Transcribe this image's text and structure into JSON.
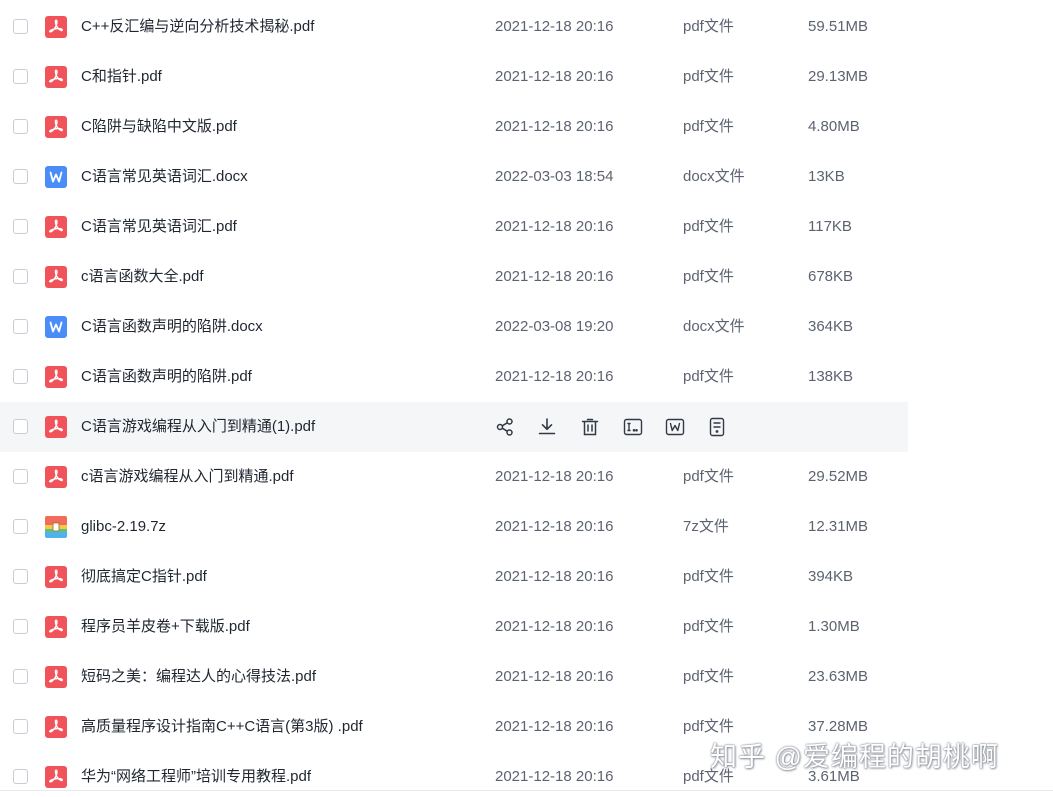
{
  "files": [
    {
      "name": "C++反汇编与逆向分析技术揭秘.pdf",
      "date": "2021-12-18 20:16",
      "type": "pdf文件",
      "size": "59.51MB",
      "icon": "pdf-icon"
    },
    {
      "name": "C和指针.pdf",
      "date": "2021-12-18 20:16",
      "type": "pdf文件",
      "size": "29.13MB",
      "icon": "pdf-icon"
    },
    {
      "name": "C陷阱与缺陷中文版.pdf",
      "date": "2021-12-18 20:16",
      "type": "pdf文件",
      "size": "4.80MB",
      "icon": "pdf-icon"
    },
    {
      "name": "C语言常见英语词汇.docx",
      "date": "2022-03-03 18:54",
      "type": "docx文件",
      "size": "13KB",
      "icon": "word-icon"
    },
    {
      "name": "C语言常见英语词汇.pdf",
      "date": "2021-12-18 20:16",
      "type": "pdf文件",
      "size": "117KB",
      "icon": "pdf-icon"
    },
    {
      "name": "c语言函数大全.pdf",
      "date": "2021-12-18 20:16",
      "type": "pdf文件",
      "size": "678KB",
      "icon": "pdf-icon"
    },
    {
      "name": "C语言函数声明的陷阱.docx",
      "date": "2022-03-08 19:20",
      "type": "docx文件",
      "size": "364KB",
      "icon": "word-icon"
    },
    {
      "name": "C语言函数声明的陷阱.pdf",
      "date": "2021-12-18 20:16",
      "type": "pdf文件",
      "size": "138KB",
      "icon": "pdf-icon"
    },
    {
      "name": "C语言游戏编程从入门到精通(1).pdf",
      "date": "",
      "type": "",
      "size": "",
      "icon": "pdf-icon",
      "hover": true
    },
    {
      "name": "c语言游戏编程从入门到精通.pdf",
      "date": "2021-12-18 20:16",
      "type": "pdf文件",
      "size": "29.52MB",
      "icon": "pdf-icon"
    },
    {
      "name": "glibc-2.19.7z",
      "date": "2021-12-18 20:16",
      "type": "7z文件",
      "size": "12.31MB",
      "icon": "archive-icon"
    },
    {
      "name": "彻底搞定C指针.pdf",
      "date": "2021-12-18 20:16",
      "type": "pdf文件",
      "size": "394KB",
      "icon": "pdf-icon"
    },
    {
      "name": "程序员羊皮卷+下载版.pdf",
      "date": "2021-12-18 20:16",
      "type": "pdf文件",
      "size": "1.30MB",
      "icon": "pdf-icon"
    },
    {
      "name": "短码之美：编程达人的心得技法.pdf",
      "date": "2021-12-18 20:16",
      "type": "pdf文件",
      "size": "23.63MB",
      "icon": "pdf-icon"
    },
    {
      "name": "高质量程序设计指南C++C语言(第3版) .pdf",
      "date": "2021-12-18 20:16",
      "type": "pdf文件",
      "size": "37.28MB",
      "icon": "pdf-icon"
    },
    {
      "name": "华为“网络工程师”培训专用教程.pdf",
      "date": "2021-12-18 20:16",
      "type": "pdf文件",
      "size": "3.61MB",
      "icon": "pdf-icon"
    }
  ],
  "hover_actions": [
    "share-icon",
    "download-icon",
    "delete-icon",
    "rename-icon",
    "word-convert-icon",
    "more-icon"
  ],
  "watermark": "知乎 @爱编程的胡桃啊",
  "colors": {
    "pdf_icon": "#f0545a",
    "word_icon": "#4a8df8",
    "hover_row_bg": "#f5f6f8"
  }
}
